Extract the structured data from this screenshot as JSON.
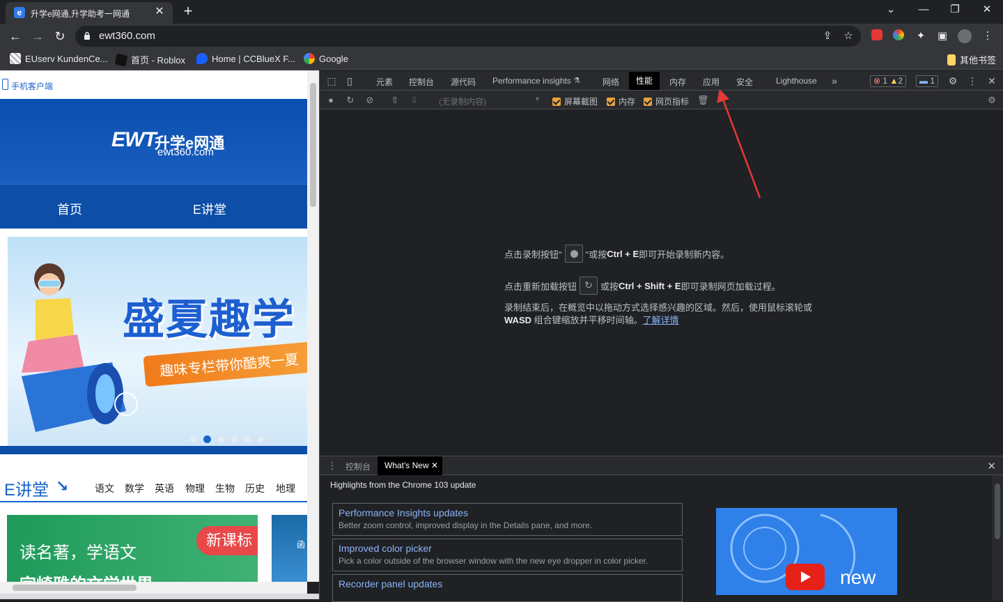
{
  "browser": {
    "tab_title": "升学e网通,升学助考一网通",
    "url": "ewt360.com",
    "bookmarks": [
      {
        "label": "EUserv KundenCe..."
      },
      {
        "label": "首页 - Roblox"
      },
      {
        "label": "Home | CCBlueX F..."
      },
      {
        "label": "Google"
      }
    ],
    "other_bookmarks": "其他书签"
  },
  "site": {
    "mobile_client": "手机客户端",
    "logo_mark": "EWT",
    "logo_cn": "升学e网通",
    "logo_domain": "ewt360.com",
    "nav": [
      "首页",
      "E讲堂"
    ],
    "banner_headline": "盛夏趣学",
    "banner_ribbon": "趣味专栏带你酷爽一夏",
    "section_title": "E讲堂",
    "subjects": [
      "语文",
      "数学",
      "英语",
      "物理",
      "生物",
      "历史",
      "地理"
    ],
    "card_text": "读名著，学语文",
    "card_text_2": "字崎雅的文学世界",
    "card_badge": "新课标",
    "card2_text": "函"
  },
  "devtools": {
    "tabs": [
      "元素",
      "控制台",
      "源代码",
      "Performance insights",
      "网络",
      "性能",
      "内存",
      "应用",
      "安全",
      "Lighthouse"
    ],
    "selected_tab": "性能",
    "error_count": "1",
    "warning_count": "2",
    "message_count": "1",
    "recording_select": "(无录制内容)",
    "checkboxes": [
      "屏幕截图",
      "内存",
      "网页指标"
    ],
    "landing": {
      "line1_a": "点击录制按钮\"",
      "line1_b": "\"或按 ",
      "line1_key": "Ctrl + E",
      "line1_c": " 即可开始录制新内容。",
      "line2_a": "点击重新加载按钮",
      "line2_b": "或按 ",
      "line2_key": "Ctrl + Shift + E",
      "line2_c": " 即可录制网页加载过程。",
      "para_a": "录制结束后，在概览中以拖动方式选择感兴趣的区域。然后，使用鼠标滚轮或 ",
      "para_key": "WASD",
      "para_b": " 组合键缩放并平移时间轴。",
      "para_link": "了解详情"
    },
    "drawer": {
      "tab_console": "控制台",
      "tab_whatsnew": "What's New",
      "highlights": "Highlights from the Chrome 103 update",
      "features": [
        {
          "title": "Performance Insights updates",
          "desc": "Better zoom control, improved display in the Details pane, and more."
        },
        {
          "title": "Improved color picker",
          "desc": "Pick a color outside of the browser window with the new eye dropper in color picker."
        },
        {
          "title": "Recorder panel updates",
          "desc": ""
        }
      ],
      "video_text": "new"
    }
  },
  "colors": {
    "accent": "#1a64c9",
    "devtools_bg": "#202124",
    "link": "#8ab4f8",
    "annotation_arrow": "#e53935"
  }
}
